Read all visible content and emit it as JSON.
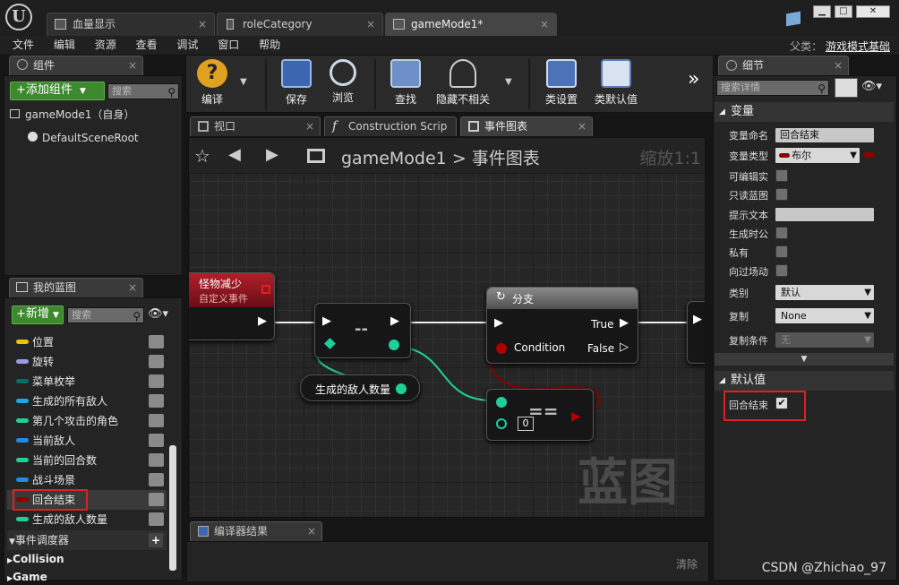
{
  "window": {
    "tabs": [
      {
        "label": "血量显示"
      },
      {
        "label": "roleCategory"
      },
      {
        "label": "gameMode1*"
      }
    ]
  },
  "menu": [
    "文件",
    "编辑",
    "资源",
    "查看",
    "调试",
    "窗口",
    "帮助"
  ],
  "parent_class": {
    "label": "父类：",
    "value": "游戏模式基础"
  },
  "components_panel": {
    "title": "组件",
    "add_button": "+添加组件",
    "search_placeholder": "搜索",
    "root_item": "gameMode1（自身）",
    "child_item": "DefaultSceneRoot"
  },
  "my_blueprint": {
    "title": "我的蓝图",
    "new_button": "+新增",
    "search_placeholder": "搜索",
    "variables": [
      {
        "label": "位置",
        "color": "#e8c400"
      },
      {
        "label": "旋转",
        "color": "#9a9ae8"
      },
      {
        "label": "菜单枚举",
        "color": "#0a6e62"
      },
      {
        "label": "生成的所有敌人",
        "color": "#1fa3e8"
      },
      {
        "label": "第几个攻击的角色",
        "color": "#1fcf9a"
      },
      {
        "label": "当前敌人",
        "color": "#1f8ae8"
      },
      {
        "label": "当前的回合数",
        "color": "#1fcf9a"
      },
      {
        "label": "战斗场景",
        "color": "#1f8ae8"
      },
      {
        "label": "回合结束",
        "color": "#8a0000"
      },
      {
        "label": "生成的敌人数量",
        "color": "#1fcf9a"
      }
    ],
    "event_dispatchers": "事件调度器",
    "categories": [
      "Collision",
      "Game"
    ]
  },
  "toolbar": [
    {
      "label": "编译",
      "icon": "compile-icon"
    },
    {
      "label": "保存",
      "icon": "save-icon"
    },
    {
      "label": "浏览",
      "icon": "browse-icon"
    },
    {
      "label": "查找",
      "icon": "find-icon"
    },
    {
      "label": "隐藏不相关",
      "icon": "hide-unrelated-icon"
    },
    {
      "label": "类设置",
      "icon": "class-settings-icon"
    },
    {
      "label": "类默认值",
      "icon": "class-defaults-icon"
    }
  ],
  "editor_tabs": [
    {
      "label": "视口"
    },
    {
      "label": "Construction Scrip"
    },
    {
      "label": "事件图表"
    }
  ],
  "graph": {
    "breadcrumb": "gameMode1",
    "breadcrumb_sep": ">",
    "breadcrumb_current": "事件图表",
    "zoom": "缩放1:1",
    "watermark": "蓝图",
    "event_node": {
      "title": "怪物减少",
      "subtitle": "自定义事件"
    },
    "equal_node": {
      "label": "--"
    },
    "branch_node": {
      "title": "分支",
      "condition": "Condition",
      "true_pin": "True",
      "false_pin": "False"
    },
    "variable_node": {
      "label": "生成的敌人数量"
    },
    "compare_node": {
      "label": "==",
      "value": "0"
    }
  },
  "compiler_results": {
    "title": "编译器结果",
    "clear_button": "清除"
  },
  "details": {
    "title": "细节",
    "search_placeholder": "搜索详情",
    "variable_section": "变量",
    "fields": {
      "name_label": "变量命名",
      "name_value": "回合结束",
      "type_label": "变量类型",
      "type_value": "布尔",
      "editable_label": "可编辑实",
      "readonly_label": "只读蓝图",
      "tooltip_label": "提示文本",
      "expose_label": "生成时公",
      "private_label": "私有",
      "cinematic_label": "向过场动",
      "category_label": "类别",
      "category_value": "默认",
      "replication_label": "复制",
      "replication_value": "None",
      "repcond_label": "复制条件",
      "repcond_value": "无"
    },
    "default_section": "默认值",
    "default_label": "回合结束",
    "default_checked": true
  },
  "watermark_credit": "CSDN @Zhichao_97"
}
